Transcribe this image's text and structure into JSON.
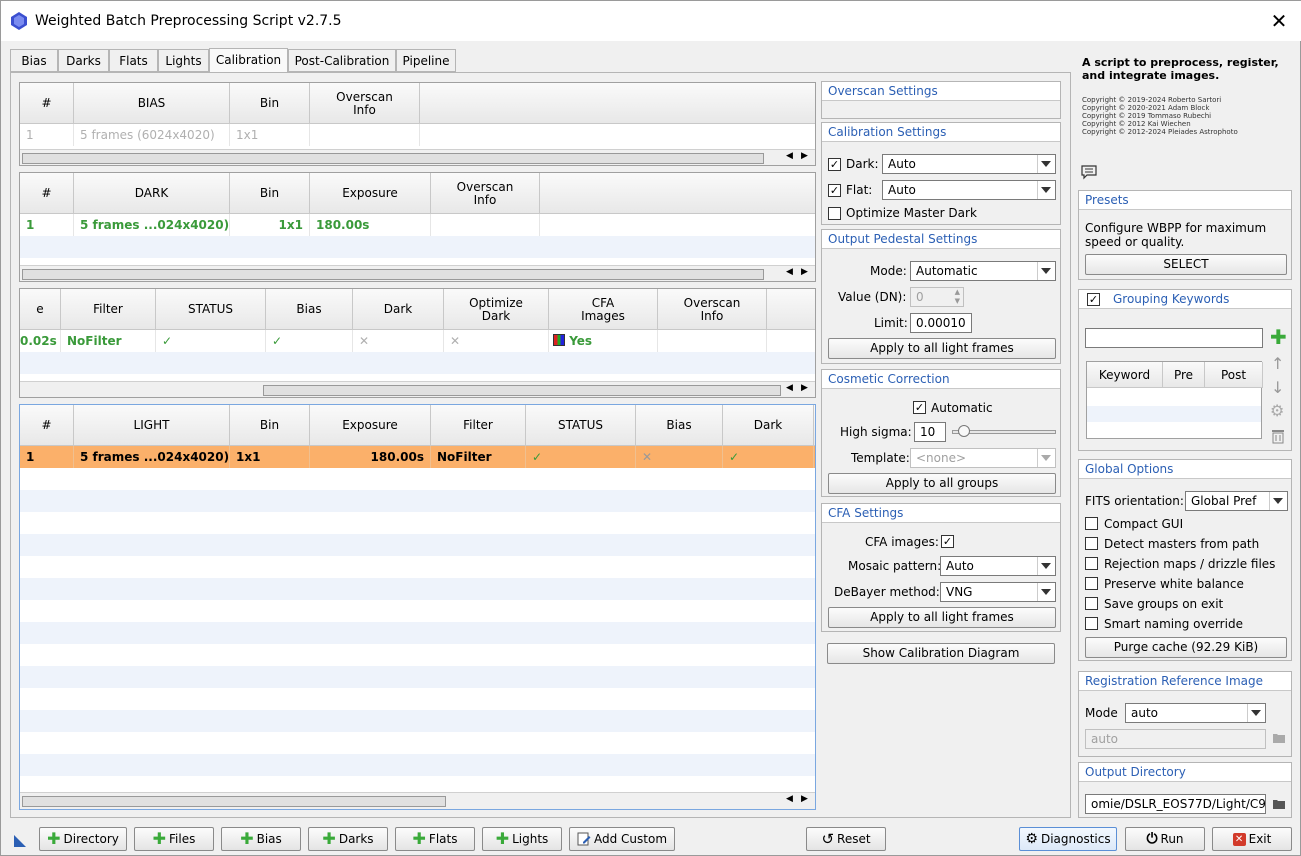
{
  "window": {
    "title": "Weighted Batch Preprocessing Script v2.7.5",
    "close": "✕"
  },
  "tabs": [
    "Bias",
    "Darks",
    "Flats",
    "Lights",
    "Calibration",
    "Post-Calibration",
    "Pipeline"
  ],
  "active_tab": "Calibration",
  "bias_table": {
    "headers": [
      "#",
      "BIAS",
      "Bin",
      "Overscan\nInfo"
    ],
    "row": [
      "1",
      "5 frames (6024x4020)",
      "1x1",
      ""
    ]
  },
  "dark_table": {
    "headers": [
      "#",
      "DARK",
      "Bin",
      "Exposure",
      "Overscan\nInfo"
    ],
    "row": [
      "1",
      "5 frames ...024x4020)",
      "1x1",
      "180.00s",
      ""
    ]
  },
  "flat_table": {
    "headers": [
      "e",
      "Filter",
      "STATUS",
      "Bias",
      "Dark",
      "Optimize\nDark",
      "CFA\nImages",
      "Overscan\nInfo"
    ],
    "row": [
      "0.02s",
      "NoFilter",
      "✓",
      "✓",
      "✕",
      "✕",
      "Yes",
      ""
    ]
  },
  "light_table": {
    "headers": [
      "#",
      "LIGHT",
      "Bin",
      "Exposure",
      "Filter",
      "STATUS",
      "Bias",
      "Dark"
    ],
    "row": [
      "1",
      "5 frames ...024x4020)",
      "1x1",
      "180.00s",
      "NoFilter",
      "✓",
      "✕",
      "✓"
    ]
  },
  "overscan": {
    "title": "Overscan Settings"
  },
  "calibration": {
    "title": "Calibration Settings",
    "dark_label": "Dark:",
    "dark_value": "Auto",
    "flat_label": "Flat:",
    "flat_value": "Auto",
    "optimize_label": "Optimize Master Dark"
  },
  "pedestal": {
    "title": "Output Pedestal Settings",
    "mode_label": "Mode:",
    "mode_value": "Automatic",
    "value_label": "Value (DN):",
    "value_value": "0",
    "limit_label": "Limit:",
    "limit_value": "0.00010",
    "apply": "Apply to all light frames"
  },
  "cosmetic": {
    "title": "Cosmetic Correction",
    "automatic": "Automatic",
    "sigma_label": "High sigma:",
    "sigma_value": "10",
    "template_label": "Template:",
    "template_value": "<none>",
    "apply": "Apply to all groups"
  },
  "cfa": {
    "title": "CFA Settings",
    "images_label": "CFA images:",
    "mosaic_label": "Mosaic pattern:",
    "mosaic_value": "Auto",
    "debayer_label": "DeBayer method:",
    "debayer_value": "VNG",
    "apply": "Apply to all light frames"
  },
  "show_diagram": "Show Calibration Diagram",
  "about": {
    "desc": "A script to preprocess, register, and integrate images.",
    "copyrights": [
      "Copyright © 2019-2024 Roberto Sartori",
      "Copyright © 2020-2021 Adam Block",
      "Copyright © 2019 Tommaso Rubechi",
      "Copyright © 2012 Kai Wiechen",
      "Copyright © 2012-2024 Pleiades Astrophoto"
    ]
  },
  "presets": {
    "title": "Presets",
    "desc": "Configure WBPP for maximum speed or quality.",
    "select": "SELECT"
  },
  "grouping": {
    "title": "Grouping Keywords",
    "headers": [
      "Keyword",
      "Pre",
      "Post"
    ]
  },
  "global": {
    "title": "Global Options",
    "fits_label": "FITS orientation:",
    "fits_value": "Global Pref",
    "options": [
      "Compact GUI",
      "Detect masters from path",
      "Rejection maps / drizzle files",
      "Preserve white balance",
      "Save groups on exit",
      "Smart naming override"
    ],
    "purge": "Purge cache (92.29 KiB)"
  },
  "registration": {
    "title": "Registration Reference Image",
    "mode_label": "Mode",
    "mode_value": "auto",
    "field_value": "auto"
  },
  "output": {
    "title": "Output Directory",
    "path": "omie/DSLR_EOS77D/Light/C9"
  },
  "bottom": {
    "directory": "Directory",
    "files": "Files",
    "bias": "Bias",
    "darks": "Darks",
    "flats": "Flats",
    "lights": "Lights",
    "add_custom": "Add Custom",
    "reset": "Reset",
    "diagnostics": "Diagnostics",
    "run": "Run",
    "exit": "Exit"
  },
  "colors": {
    "accent_blue": "#2b5fb4",
    "selected_row": "#fbb06a",
    "green": "#3a9a3a",
    "exit_red": "#d23a2a"
  }
}
